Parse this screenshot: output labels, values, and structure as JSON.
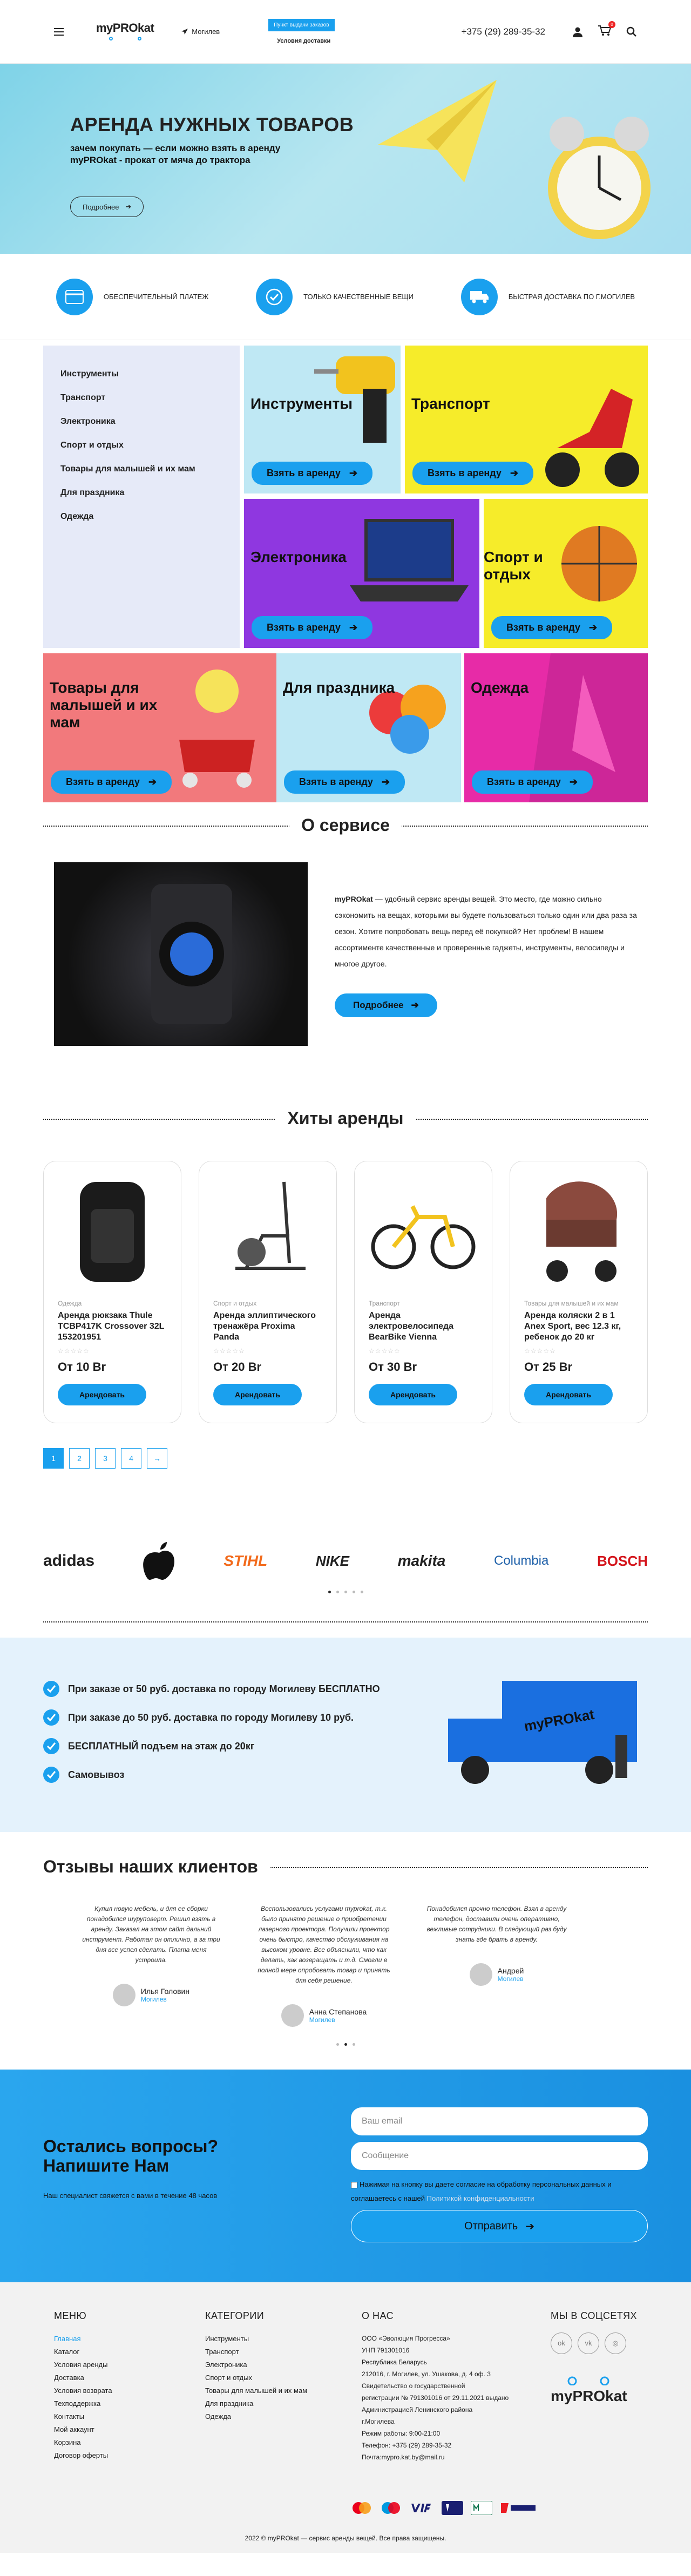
{
  "header": {
    "logo_text": "myPROkat",
    "city": "Могилев",
    "nav_pill": "Пункт выдачи заказов",
    "nav_link": "Условия доставки",
    "phone": "+375 (29) 289-35-32",
    "cart_count": "0"
  },
  "hero": {
    "title": "АРЕНДА НУЖНЫХ ТОВАРОВ",
    "subtitle": "зачем покупать — если можно взять в аренду myPROkat - прокат от мяча до трактора",
    "button": "Подробнее"
  },
  "features": [
    {
      "label": "ОБЕСПЕЧИТЕЛЬНЫЙ ПЛАТЕЖ",
      "icon": "card-icon"
    },
    {
      "label": "ТОЛЬКО КАЧЕСТВЕННЫЕ ВЕЩИ",
      "icon": "check-icon"
    },
    {
      "label": "БЫСТРАЯ ДОСТАВКА ПО Г.МОГИЛЕВ",
      "icon": "truck-icon"
    }
  ],
  "categories_menu": [
    "Инструменты",
    "Транспорт",
    "Электроника",
    "Спорт и отдых",
    "Товары для малышей и их мам",
    "Для праздника",
    "Одежда"
  ],
  "tiles": {
    "btn": "Взять в аренду",
    "tools": "Инструменты",
    "transport": "Транспорт",
    "electronics": "Электроника",
    "sport": "Спорт и отдых",
    "kids": "Товары для малышей и их мам",
    "holiday": "Для праздника",
    "clothes": "Одежда"
  },
  "about": {
    "heading": "О сервисе",
    "brand": "myPROkat",
    "text": " — удобный сервис аренды вещей. Это место, где можно сильно сэкономить на вещах, которыми вы будете пользоваться только один или два раза за сезон. Хотите попробовать вещь перед её покупкой? Нет проблем! В нашем ассортименте качественные и проверенные гаджеты, инструменты, велосипеды и многое другое.",
    "button": "Подробнее"
  },
  "hits": {
    "heading": "Хиты аренды",
    "button": "Арендовать",
    "stars": "☆☆☆☆☆",
    "items": [
      {
        "category": "Одежда",
        "name": "Аренда рюкзака Thule TCBP417K Crossover 32L 153201951",
        "price": "От 10 Br"
      },
      {
        "category": "Спорт и отдых",
        "name": "Аренда эллиптического тренажёра Proxima Panda",
        "price": "От 20 Br"
      },
      {
        "category": "Транспорт",
        "name": "Аренда электровелосипеда BearBike Vienna",
        "price": "От 30 Br"
      },
      {
        "category": "Товары для малышей и их мам",
        "name": "Аренда коляски 2 в 1 Anex Sport, вес 12.3 кг, ребенок до 20 кг",
        "price": "От 25 Br"
      }
    ]
  },
  "pagination": [
    "1",
    "2",
    "3",
    "4",
    "→"
  ],
  "brands": [
    "adidas",
    "apple",
    "STIHL",
    "NIKE",
    "makita",
    "Columbia",
    "BOSCH"
  ],
  "delivery": [
    "При заказе от 50 руб. доставка по городу Могилеву БЕСПЛАТНО",
    "При заказе до 50 руб. доставка по городу Могилеву 10 руб.",
    "БЕСПЛАТНЫЙ подъем на этаж до 20кг",
    "Самовывоз"
  ],
  "truck_text": "myPROkat",
  "reviews": {
    "heading": "Отзывы наших клиентов",
    "items": [
      {
        "text": "Купил новую мебель, и для ее сборки понадобился шуруповерт. Решил взять в аренду. Заказал на этом сайт дальний инструмент. Работал он отлично, а за три дня все успел сделать. Плата меня устроила.",
        "name": "Илья Головин",
        "city": "Могилев"
      },
      {
        "text": "Воспользовались услугами myprokat, т.к. было принято решение о приобретении лазерного проектора. Получили проектор очень быстро, качество обслуживания на высоком уровне. Все объяснили, что как делать, как возвращать и т.д. Смогли в полной мере опробовать товар и принять для себя решение.",
        "name": "Анна Степанова",
        "city": "Могилев"
      },
      {
        "text": "Понадобился прочно телефон. Взял в аренду телефон, доставили очень оперативно, вежливые сотрудники. В следующий раз буду знать где брать в аренду.",
        "name": "Андрей",
        "city": "Могилев"
      }
    ]
  },
  "contact": {
    "title": "Остались вопросы? Напишите Нам",
    "sub": "Наш специалист свяжется с вами в течение 48 часов",
    "email_placeholder": "Ваш email",
    "msg_placeholder": "Сообщение",
    "agree": "Нажимая на кнопку вы даете согласие на обработку персональных данных и соглашаетесь с нашей ",
    "policy": "Политикой конфиденциальности",
    "send": "Отправить"
  },
  "footer": {
    "menu_h": "МЕНЮ",
    "menu": [
      "Главная",
      "Каталог",
      "Условия аренды",
      "Доставка",
      "Условия возврата",
      "Техподдержка",
      "Контакты",
      "Мой аккаунт",
      "Корзина",
      "Договор оферты"
    ],
    "cat_h": "КАТЕГОРИИ",
    "cats": [
      "Инструменты",
      "Транспорт",
      "Электроника",
      "Спорт и отдых",
      "Товары для малышей и их мам",
      "Для праздника",
      "Одежда"
    ],
    "about_h": "О НАС",
    "about": [
      "ООО «Эволюция Прогресса»",
      "УНП 791301016",
      "Республика Беларусь",
      "212016, г. Могилев, ул. Ушакова, д. 4 оф. 3",
      "Свидетельство о государственной",
      "регистрации № 791301016 от 29.11.2021 выдано",
      "Администрацией Ленинского района",
      "г.Могилева",
      "Режим работы: 9:00-21:00",
      "Телефон: +375 (29) 289-35-32",
      "Почта:mypro.kat.by@mail.ru"
    ],
    "soc_h": "МЫ В СОЦСЕТЯХ",
    "logo_text": "myPROkat",
    "copyright": "2022 © myPROkat — сервис аренды вещей. Все права защищены."
  }
}
